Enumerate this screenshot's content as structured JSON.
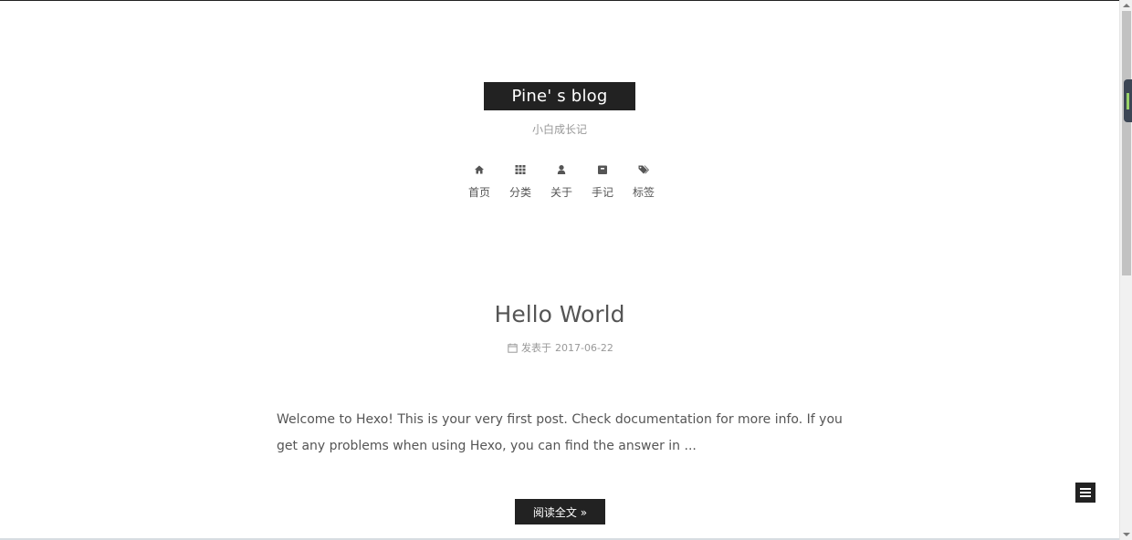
{
  "site": {
    "title": "Pine' s blog",
    "subtitle": "小白成长记"
  },
  "nav": {
    "items": [
      {
        "label": "首页",
        "icon": "home-icon"
      },
      {
        "label": "分类",
        "icon": "th-grid-icon"
      },
      {
        "label": "关于",
        "icon": "user-icon"
      },
      {
        "label": "手记",
        "icon": "archive-icon"
      },
      {
        "label": "标签",
        "icon": "tags-icon"
      }
    ]
  },
  "post": {
    "title": "Hello World",
    "meta_icon": "calendar-icon",
    "meta_prefix": "发表于",
    "date": "2017-06-22",
    "excerpt": "Welcome to Hexo! This is your very first post. Check documentation for more info. If you get any problems when using Hexo, you can find the answer in ...",
    "read_more_label": "阅读全文 »"
  },
  "sidebar_toggle": {
    "icon": "menu-icon"
  },
  "colors": {
    "brand_bg": "#222222",
    "text": "#555555",
    "muted": "#999999"
  }
}
